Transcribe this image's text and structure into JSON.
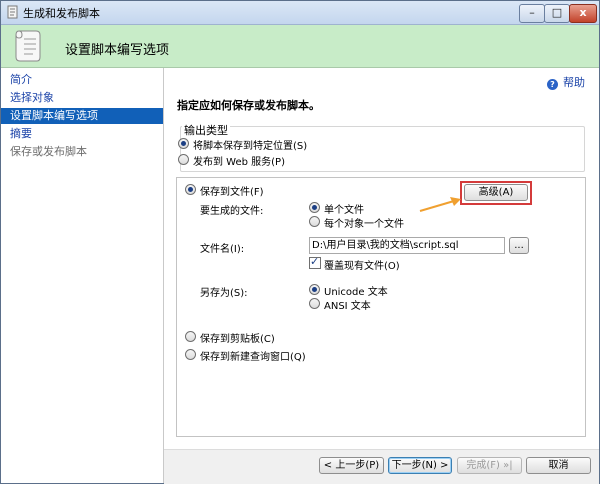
{
  "window": {
    "title": "生成和发布脚本",
    "minimize_glyph": "–",
    "maximize_glyph": "□",
    "close_glyph": "x"
  },
  "header": {
    "title": "设置脚本编写选项",
    "icon": "scroll-icon"
  },
  "nav": {
    "items": [
      {
        "label": "简介",
        "state": "normal"
      },
      {
        "label": "选择对象",
        "state": "normal"
      },
      {
        "label": "设置脚本编写选项",
        "state": "active"
      },
      {
        "label": "摘要",
        "state": "normal"
      },
      {
        "label": "保存或发布脚本",
        "state": "disabled"
      }
    ]
  },
  "help": {
    "label": "帮助",
    "glyph": "?"
  },
  "main": {
    "instruction": "指定应如何保存或发布脚本。",
    "output_type": {
      "legend": "输出类型",
      "options": [
        {
          "label": "将脚本保存到特定位置(S)",
          "checked": true
        },
        {
          "label": "发布到 Web 服务(P)",
          "checked": false
        }
      ]
    },
    "save_to_file": {
      "label": "保存到文件(F)",
      "checked": true,
      "advanced_label": "高级(A)",
      "files_label": "要生成的文件:",
      "file_options": [
        {
          "label": "单个文件",
          "checked": true
        },
        {
          "label": "每个对象一个文件",
          "checked": false
        }
      ],
      "filename_label": "文件名(I):",
      "filename_value": "D:\\用户目录\\我的文档\\script.sql",
      "browse_label": "...",
      "overwrite_label": "覆盖现有文件(O)",
      "overwrite_checked": true,
      "saveas_label": "另存为(S):",
      "saveas_options": [
        {
          "label": "Unicode 文本",
          "checked": true
        },
        {
          "label": "ANSI 文本",
          "checked": false
        }
      ]
    },
    "other_options": [
      {
        "label": "保存到剪贴板(C)",
        "checked": false
      },
      {
        "label": "保存到新建查询窗口(Q)",
        "checked": false
      }
    ]
  },
  "footer": {
    "prev_label": "< 上一步(P)",
    "next_label": "下一步(N) >",
    "finish_label": "完成(F)",
    "finish_glyph": "»|",
    "cancel_label": "取消"
  },
  "colors": {
    "header_bg": "#c8ecc8",
    "nav_active": "#1160b8",
    "link": "#1b43a8",
    "highlight": "#d43b3b",
    "arrow": "#f0a030"
  }
}
